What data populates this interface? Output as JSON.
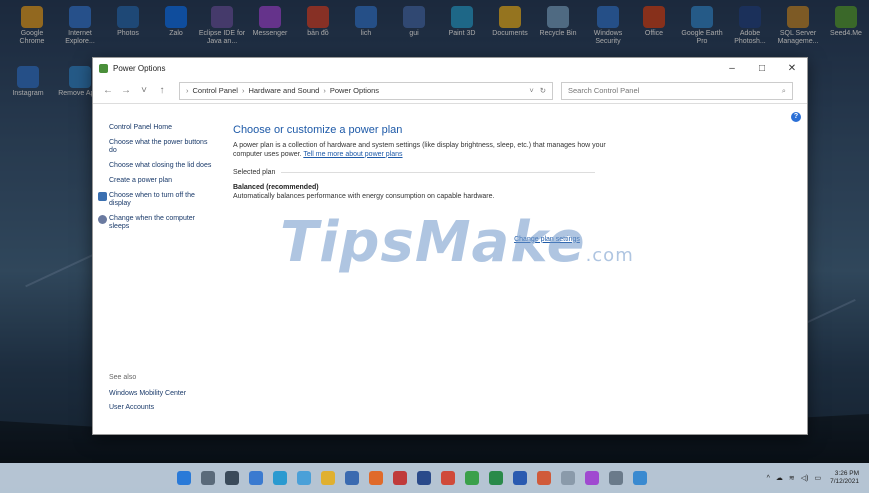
{
  "desktop": {
    "icons": [
      {
        "label": "Google Chrome",
        "color": "#e0a030"
      },
      {
        "label": "Internet Explore...",
        "color": "#3b7bd4"
      },
      {
        "label": "Photos",
        "color": "#2f6fb5"
      },
      {
        "label": "Zalo",
        "color": "#1877f2"
      },
      {
        "label": "Eclipse IDE for Java an...",
        "color": "#6b5aa5"
      },
      {
        "label": "Messenger",
        "color": "#9b4fd6"
      },
      {
        "label": "bản đồ",
        "color": "#d04a3a"
      },
      {
        "label": "lich",
        "color": "#3a7ad0"
      },
      {
        "label": "gui",
        "color": "#4a6fb0"
      },
      {
        "label": "Paint 3D",
        "color": "#2f9fd0"
      },
      {
        "label": "Documents",
        "color": "#e5b330"
      },
      {
        "label": "Recycle Bin",
        "color": "#7aa4c8"
      },
      {
        "label": "Windows Security",
        "color": "#3a7ad0"
      },
      {
        "label": "Office",
        "color": "#d04a2a"
      },
      {
        "label": "Google Earth Pro",
        "color": "#3a8ad0"
      },
      {
        "label": "Adobe Photosh...",
        "color": "#2a4a8a"
      },
      {
        "label": "SQL Server Manageme...",
        "color": "#c08a3a"
      },
      {
        "label": "Seed4.Me",
        "color": "#5aa040"
      }
    ],
    "side_icons": [
      {
        "label": "Instagram",
        "color": "#3a7ad0"
      },
      {
        "label": "Remove Apps",
        "color": "#3a8ad0"
      }
    ]
  },
  "window": {
    "title": "Power Options",
    "minimize": "–",
    "maximize": "□",
    "close": "✕",
    "nav": {
      "back": "←",
      "forward": "→",
      "recent": "˅",
      "up": "↑"
    },
    "breadcrumb": [
      "Control Panel",
      "Hardware and Sound",
      "Power Options"
    ],
    "breadcrumb_dropdown": "˅",
    "refresh": "↻",
    "search_placeholder": "Search Control Panel",
    "search_icon": "⌕",
    "help": "?"
  },
  "left_pane": {
    "items": [
      "Control Panel Home",
      "Choose what the power buttons do",
      "Choose what closing the lid does",
      "Create a power plan",
      "Choose when to turn off the display",
      "Change when the computer sleeps"
    ],
    "see_also_label": "See also",
    "see_also": [
      "Windows Mobility Center",
      "User Accounts"
    ]
  },
  "main": {
    "heading": "Choose or customize a power plan",
    "description": "A power plan is a collection of hardware and system settings (like display brightness, sleep, etc.) that manages how your computer uses power.",
    "learn_more": "Tell me more about power plans",
    "selected_plan_label": "Selected plan",
    "plan_name": "Balanced (recommended)",
    "plan_description": "Automatically balances performance with energy consumption on capable hardware.",
    "change_link": "Change plan settings"
  },
  "watermark": {
    "text": "TipsMake",
    "suffix": ".com"
  },
  "taskbar": {
    "apps": [
      {
        "name": "start",
        "color": "#2a7ad8"
      },
      {
        "name": "search",
        "color": "#5a6a7a"
      },
      {
        "name": "task-view",
        "color": "#3a4a5a"
      },
      {
        "name": "widgets",
        "color": "#3a7ad0"
      },
      {
        "name": "edge",
        "color": "#2a9ad0"
      },
      {
        "name": "store-bag",
        "color": "#4aa0d8"
      },
      {
        "name": "file-explorer",
        "color": "#e0b030"
      },
      {
        "name": "mail",
        "color": "#3a6ab0"
      },
      {
        "name": "firefox",
        "color": "#e06a2a"
      },
      {
        "name": "unikey",
        "color": "#c03a3a"
      },
      {
        "name": "photoshop",
        "color": "#2a4a8a"
      },
      {
        "name": "chrome",
        "color": "#d04a3a"
      },
      {
        "name": "notepad",
        "color": "#3aa04a"
      },
      {
        "name": "excel",
        "color": "#2a8a4a"
      },
      {
        "name": "word",
        "color": "#2a5ab0"
      },
      {
        "name": "powerpoint",
        "color": "#d05a3a"
      },
      {
        "name": "snipping",
        "color": "#8a9aaa"
      },
      {
        "name": "paint",
        "color": "#a04ad0"
      },
      {
        "name": "settings",
        "color": "#6a7a8a"
      },
      {
        "name": "photos-app",
        "color": "#3a8ad0"
      }
    ],
    "tray": {
      "chevron": "^",
      "cloud": "☁",
      "wifi": "≋",
      "volume": "◁)",
      "battery": "▭"
    },
    "time": "3:26 PM",
    "date": "7/12/2021"
  }
}
